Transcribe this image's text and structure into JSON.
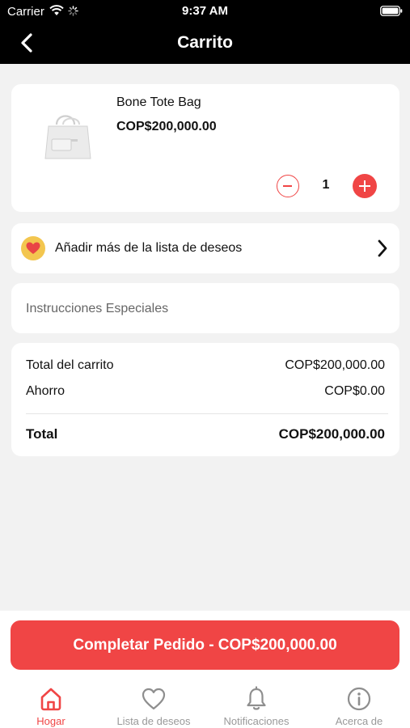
{
  "status_bar": {
    "carrier": "Carrier",
    "time": "9:37 AM"
  },
  "nav": {
    "title": "Carrito"
  },
  "cart_item": {
    "name": "Bone Tote Bag",
    "price": "COP$200,000.00",
    "quantity": "1"
  },
  "wishlist_link": {
    "label": "Añadir más de la lista de deseos"
  },
  "special_instructions": {
    "placeholder": "Instrucciones Especiales"
  },
  "totals": {
    "cart_total_label": "Total del carrito",
    "cart_total_value": "COP$200,000.00",
    "savings_label": "Ahorro",
    "savings_value": "COP$0.00",
    "total_label": "Total",
    "total_value": "COP$200,000.00"
  },
  "checkout": {
    "label": "Completar Pedido - COP$200,000.00"
  },
  "tabs": [
    {
      "label": "Hogar",
      "icon": "home-icon",
      "active": true
    },
    {
      "label": "Lista de deseos",
      "icon": "heart-icon",
      "active": false
    },
    {
      "label": "Notificaciones",
      "icon": "bell-icon",
      "active": false
    },
    {
      "label": "Acerca de",
      "icon": "info-icon",
      "active": false
    }
  ],
  "colors": {
    "accent": "#f04545",
    "header": "#000000",
    "background": "#f2f2f2",
    "badge": "#f3c64f"
  }
}
